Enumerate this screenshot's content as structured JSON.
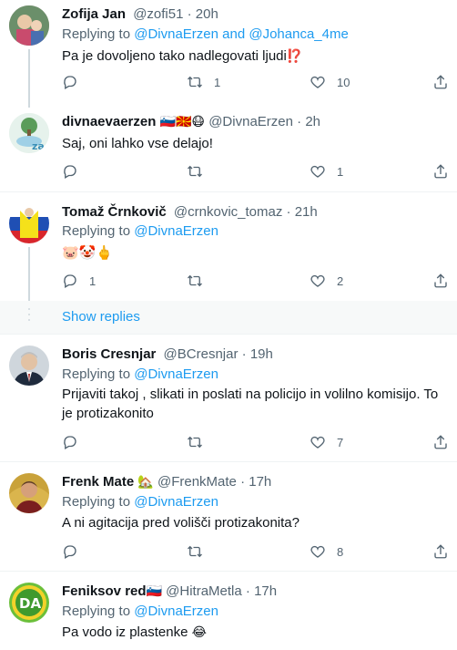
{
  "tweets": [
    {
      "name": "Zofija Jan",
      "handle": "@zofi51",
      "time": "20h",
      "replying_label": "Replying to",
      "replying_mentions": "@DivnaErzen and @Johanca_4me",
      "text": "Pa je dovoljeno tako nadlegovati ljudi",
      "text_emoji": "⁉️",
      "replies": "",
      "retweets": "1",
      "likes": "10"
    },
    {
      "name": "divnaevaerzen",
      "name_emoji": "🇸🇮🇲🇰😷",
      "handle": "@DivnaErzen",
      "time": "2h",
      "text": "Saj, oni lahko vse delajo!",
      "replies": "",
      "retweets": "",
      "likes": "1"
    },
    {
      "name": "Tomaž Črnkovič",
      "handle": "@crnkovic_tomaz",
      "time": "21h",
      "replying_label": "Replying to",
      "replying_mentions": "@DivnaErzen",
      "text": "🐷🤡🖕",
      "replies": "1",
      "retweets": "",
      "likes": "2"
    },
    {
      "name": "Boris Cresnjar",
      "handle": "@BCresnjar",
      "time": "19h",
      "replying_label": "Replying to",
      "replying_mentions": "@DivnaErzen",
      "text": "Prijaviti takoj , slikati in poslati na policijo in volilno komisijo. To je protizakonito",
      "replies": "",
      "retweets": "",
      "likes": "7"
    },
    {
      "name": "Frenk Mate",
      "name_emoji": "🏡",
      "handle": "@FrenkMate",
      "time": "17h",
      "replying_label": "Replying to",
      "replying_mentions": "@DivnaErzen",
      "text": "A ni agitacija pred volišči protizakonita?",
      "replies": "",
      "retweets": "",
      "likes": "8"
    },
    {
      "name": "Feniksov red",
      "name_emoji": "🇸🇮",
      "handle": "@HitraMetla",
      "time": "17h",
      "replying_label": "Replying to",
      "replying_mentions": "@DivnaErzen",
      "text": "Pa vodo iz plastenke",
      "text_emoji": "😂"
    }
  ],
  "show_replies": "Show replies",
  "dot": "·",
  "avatar_badges": {
    "divna": "za",
    "feniksov": "DA"
  },
  "colors": {
    "accent": "#1d9bf0",
    "secondary_text": "#536471",
    "separator": "#eff3f4"
  },
  "icons": [
    "reply-icon",
    "retweet-icon",
    "like-icon",
    "share-icon"
  ]
}
